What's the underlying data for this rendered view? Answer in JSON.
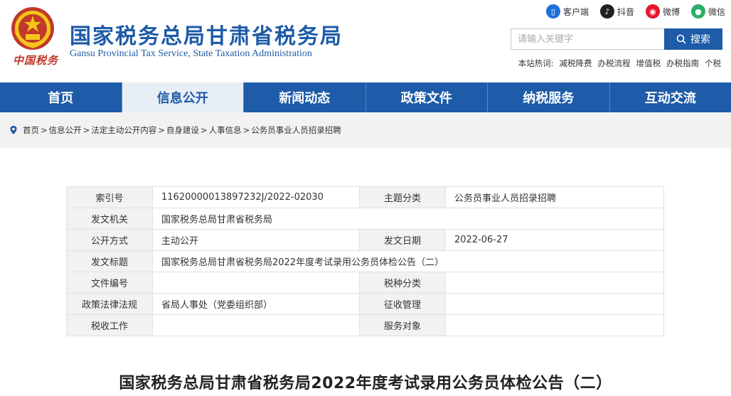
{
  "header": {
    "title": "国家税务总局甘肃省税务局",
    "subtitle": "Gansu Provincial Tax Service, State Taxation Administration",
    "brand": "中国税务"
  },
  "social": [
    {
      "label": "客户端",
      "icon": "mobile-icon",
      "color": "#1e6fd9"
    },
    {
      "label": "抖音",
      "icon": "douyin-icon",
      "color": "#222222"
    },
    {
      "label": "微博",
      "icon": "weibo-icon",
      "color": "#e6162d"
    },
    {
      "label": "微信",
      "icon": "wechat-icon",
      "color": "#2aae67"
    }
  ],
  "search": {
    "placeholder": "请输入关键字",
    "button": "搜索"
  },
  "hotwords": {
    "label": "本站热词:",
    "items": [
      "减税降费",
      "办税流程",
      "增值税",
      "办税指南",
      "个税"
    ]
  },
  "nav": [
    {
      "label": "首页",
      "active": false
    },
    {
      "label": "信息公开",
      "active": true
    },
    {
      "label": "新闻动态",
      "active": false
    },
    {
      "label": "政策文件",
      "active": false
    },
    {
      "label": "纳税服务",
      "active": false
    },
    {
      "label": "互动交流",
      "active": false
    }
  ],
  "breadcrumb": [
    "首页",
    "信息公开",
    "法定主动公开内容",
    "自身建设",
    "人事信息",
    "公务员事业人员招录招聘"
  ],
  "info": {
    "rows": [
      {
        "l1": "索引号",
        "v1": "11620000013897232J/2022-02030",
        "l2": "主题分类",
        "v2": "公务员事业人员招录招聘"
      },
      {
        "l1": "发文机关",
        "v1": "国家税务总局甘肃省税务局",
        "l2": null,
        "v2": null
      },
      {
        "l1": "公开方式",
        "v1": "主动公开",
        "l2": "发文日期",
        "v2": "2022-06-27"
      },
      {
        "l1": "发文标题",
        "v1": "国家税务总局甘肃省税务局2022年度考试录用公务员体检公告（二）",
        "l2": null,
        "v2": null
      },
      {
        "l1": "文件编号",
        "v1": "",
        "l2": "税种分类",
        "v2": ""
      },
      {
        "l1": "政策法律法规",
        "v1": "省局人事处（党委组织部）",
        "l2": "征收管理",
        "v2": ""
      },
      {
        "l1": "税收工作",
        "v1": "",
        "l2": "服务对象",
        "v2": ""
      }
    ]
  },
  "document": {
    "title": "国家税务总局甘肃省税务局2022年度考试录用公务员体检公告（二）"
  }
}
